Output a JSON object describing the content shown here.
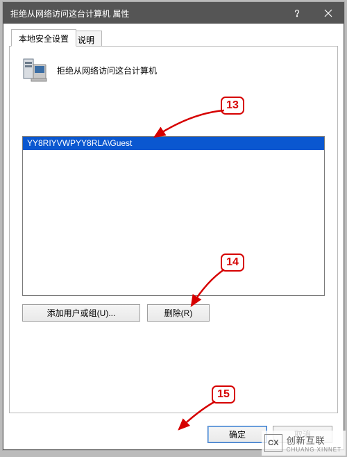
{
  "window": {
    "title": "拒绝从网络访问这台计算机 属性"
  },
  "tabs": {
    "local_security": "本地安全设置",
    "description": "说明"
  },
  "policy": {
    "title": "拒绝从网络访问这台计算机"
  },
  "list": {
    "selected_item": "YY8RIYVWPYY8RLA\\Guest"
  },
  "buttons": {
    "add": "添加用户或组(U)...",
    "remove": "删除(R)",
    "ok": "确定",
    "cancel": "取消"
  },
  "annotations": {
    "n13": "13",
    "n14": "14",
    "n15": "15"
  },
  "watermark": {
    "glyph": "CX",
    "cn": "创新互联",
    "en": "CHUANG XINNET"
  }
}
